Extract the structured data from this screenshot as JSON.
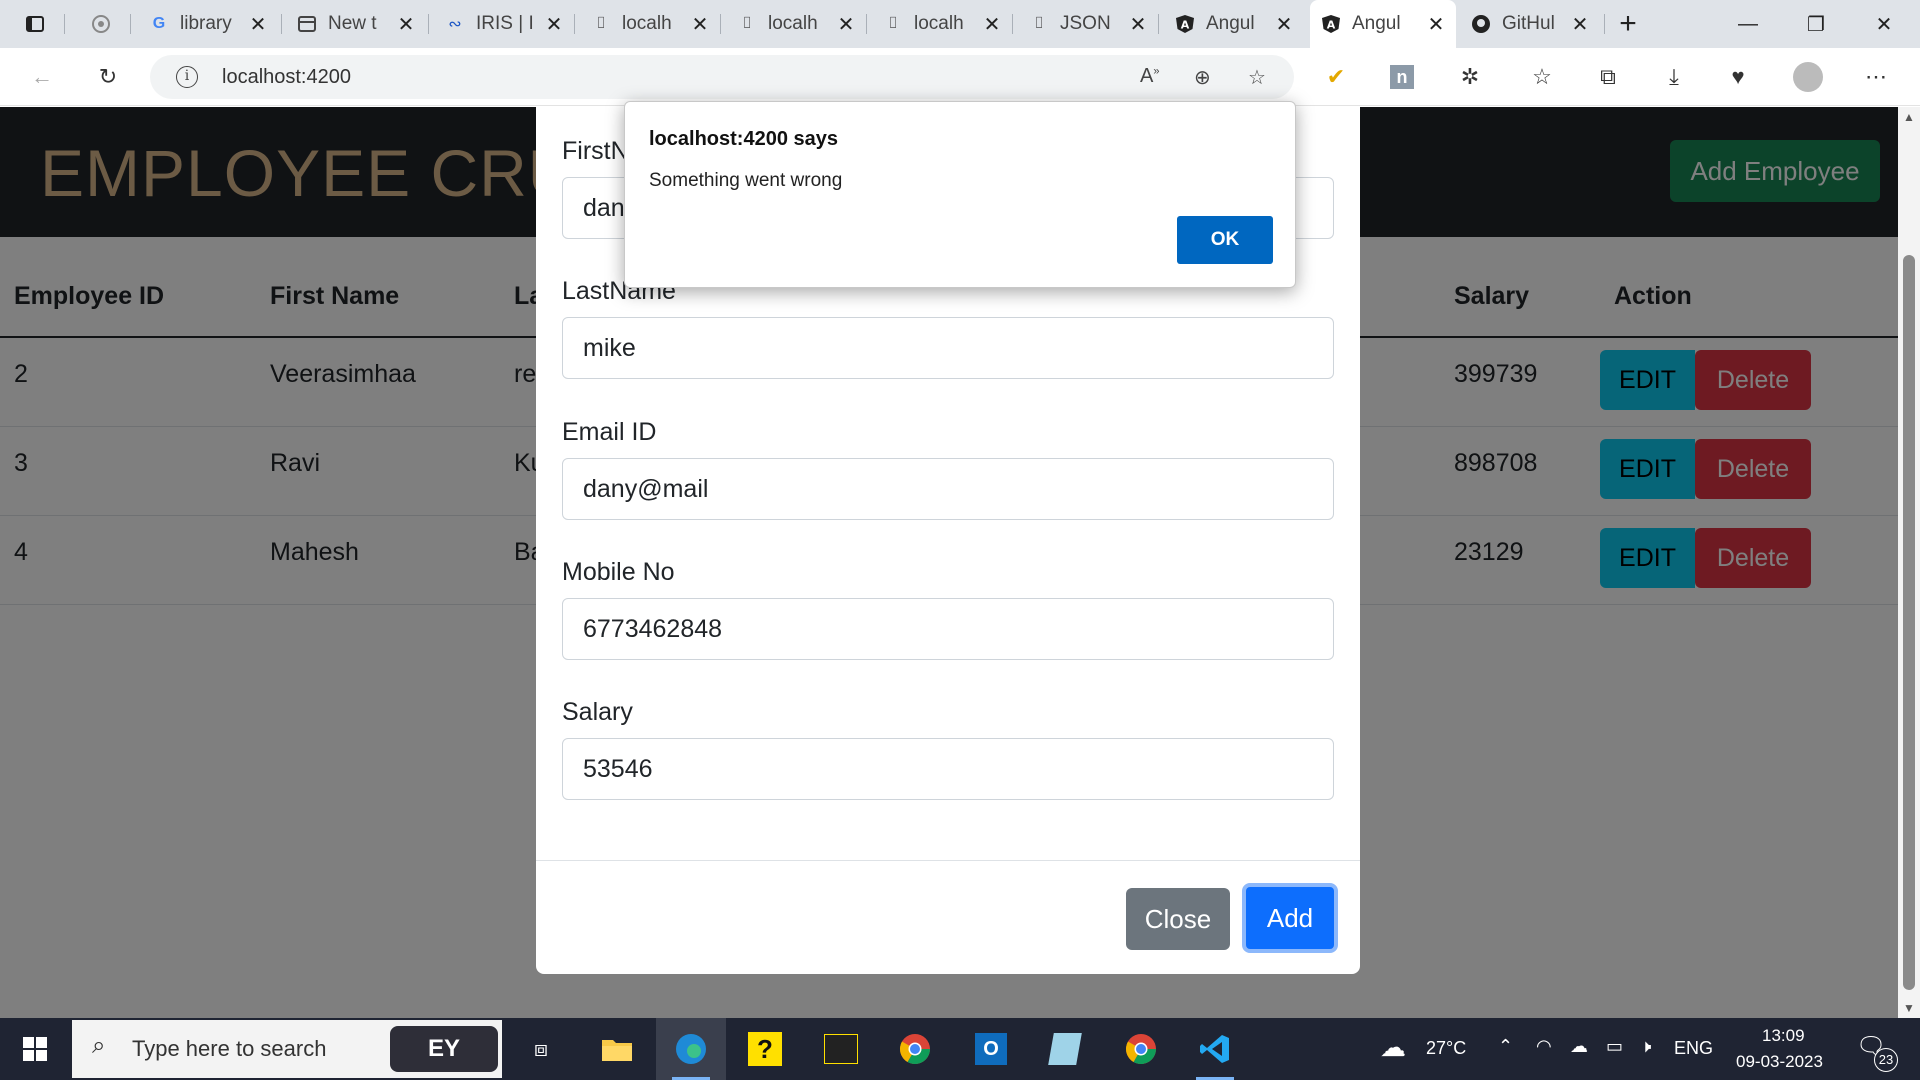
{
  "browser": {
    "tabs": [
      {
        "label": "",
        "icon": "tab-actions-icon"
      },
      {
        "label": "",
        "icon": "openai-icon"
      },
      {
        "label": "library",
        "icon": "google-icon"
      },
      {
        "label": "New t",
        "icon": "new-tab-icon"
      },
      {
        "label": "IRIS | I",
        "icon": "iris-icon"
      },
      {
        "label": "localh",
        "icon": "localhost-icon"
      },
      {
        "label": "localh",
        "icon": "localhost-icon"
      },
      {
        "label": "localh",
        "icon": "localhost-icon"
      },
      {
        "label": "JSON",
        "icon": "json-icon"
      },
      {
        "label": "Angul",
        "icon": "angular-icon"
      },
      {
        "label": "Angul",
        "icon": "angular-icon",
        "active": true
      },
      {
        "label": "GitHul",
        "icon": "github-icon"
      }
    ],
    "url": "localhost:4200"
  },
  "page": {
    "title": "EMPLOYEE CRUD",
    "add_button": "Add Employee",
    "columns": [
      "Employee ID",
      "First Name",
      "La",
      "",
      "Salary",
      "Action"
    ],
    "rows": [
      {
        "id": "2",
        "first": "Veerasimhaa",
        "last": "re",
        "salary": "399739"
      },
      {
        "id": "3",
        "first": "Ravi",
        "last": "Ku",
        "salary": "898708"
      },
      {
        "id": "4",
        "first": "Mahesh",
        "last": "Ba",
        "salary": "23129"
      }
    ],
    "edit_label": "EDIT",
    "delete_label": "Delete"
  },
  "modal": {
    "fields": [
      {
        "label": "FirstN",
        "value": "dan"
      },
      {
        "label": "LastName",
        "value": "mike"
      },
      {
        "label": "Email ID",
        "value": "dany@mail"
      },
      {
        "label": "Mobile No",
        "value": "6773462848"
      },
      {
        "label": "Salary",
        "value": "53546"
      }
    ],
    "close_label": "Close",
    "add_label": "Add"
  },
  "alert": {
    "title": "localhost:4200 says",
    "message": "Something went wrong",
    "ok_label": "OK"
  },
  "taskbar": {
    "search_placeholder": "Type here to search",
    "ey_label": "EY",
    "temperature": "27°C",
    "language": "ENG",
    "time": "13:09",
    "date": "09-03-2023",
    "notification_count": "23"
  },
  "colors": {
    "header_bg": "#212529",
    "title_color": "#d8b68a",
    "success": "#198754",
    "info": "#0dcaf0",
    "danger": "#dc3545",
    "primary": "#0d6efd",
    "secondary": "#6c757d"
  }
}
